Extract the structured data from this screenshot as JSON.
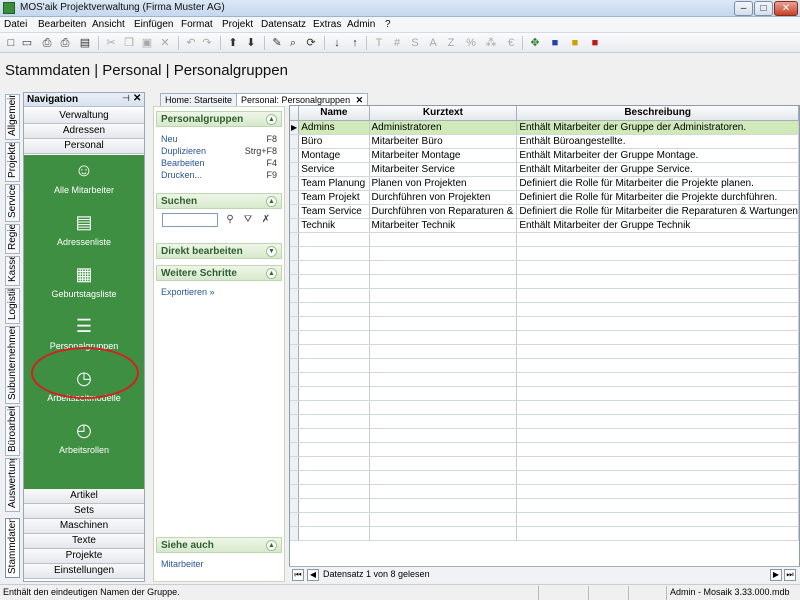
{
  "window": {
    "title": "MOS'aik Projektverwaltung (Firma Muster AG)",
    "minimize": "–",
    "maximize": "□",
    "close": "✕"
  },
  "menu": [
    "Datei",
    "Bearbeiten",
    "Ansicht",
    "Einfügen",
    "Format",
    "Projekt",
    "Datensatz",
    "Extras",
    "Admin",
    "?"
  ],
  "toolbar_icons": [
    "new-icon",
    "open-icon",
    "print-icon",
    "print-preview-icon",
    "cut-icon",
    "copy-icon",
    "paste-icon",
    "delete-icon",
    "undo-icon",
    "redo-icon",
    "arrow-up-icon",
    "arrow-down-icon",
    "pen-icon",
    "find-icon",
    "refresh-icon",
    "sort-az-icon",
    "sort-za-icon",
    "text-format-icon",
    "percent-icon",
    "currency-icon",
    "users-icon",
    "lock-blue-icon",
    "lock-yellow-icon",
    "lock-red-icon"
  ],
  "breadcrumb": "Stammdaten | Personal | Personalgruppen",
  "side_tabs": [
    "Allgemein",
    "Projekte",
    "Service",
    "Regie",
    "Kasse",
    "Logistik",
    "Subunternehmer",
    "Büroarbeiten",
    "Auswertungen",
    "Stammdaten"
  ],
  "navigation": {
    "title": "Navigation",
    "pin": "⊣",
    "close": "✕",
    "top_buttons": [
      "Verwaltung",
      "Adressen",
      "Personal"
    ],
    "items": [
      {
        "label": "Alle Mitarbeiter",
        "icon": "people-icon"
      },
      {
        "label": "Adressenliste",
        "icon": "address-list-icon"
      },
      {
        "label": "Geburtstagsliste",
        "icon": "calendar-icon"
      },
      {
        "label": "Personalgruppen",
        "icon": "database-group-icon"
      },
      {
        "label": "Arbeitszeitmodelle",
        "icon": "calendar-clock-icon"
      },
      {
        "label": "Arbeitsrollen",
        "icon": "database-clock-icon"
      }
    ],
    "bottom_buttons": [
      "Artikel",
      "Sets",
      "Maschinen",
      "Texte",
      "Projekte",
      "Einstellungen"
    ]
  },
  "tabs": [
    {
      "label": "Home: Startseite"
    },
    {
      "label": "Personal: Personalgruppen",
      "close": "✕"
    }
  ],
  "taskpane": {
    "groups": [
      {
        "title": "Personalgruppen",
        "chevron": "▲",
        "items": [
          {
            "label": "Neu",
            "shortcut": "F8"
          },
          {
            "label": "Duplizieren",
            "shortcut": "Strg+F8"
          },
          {
            "label": "Bearbeiten",
            "shortcut": "F4"
          },
          {
            "label": "Drucken...",
            "shortcut": "F9"
          }
        ]
      },
      {
        "title": "Suchen",
        "chevron": "▲"
      },
      {
        "title": "Direkt bearbeiten",
        "chevron": "▼"
      },
      {
        "title": "Weitere Schritte",
        "chevron": "▲",
        "items": [
          {
            "label": "Exportieren »"
          }
        ]
      },
      {
        "title": "Siehe auch",
        "chevron": "▲",
        "items": [
          {
            "label": "Mitarbeiter"
          }
        ]
      }
    ]
  },
  "grid": {
    "columns": [
      "Name",
      "Kurztext",
      "Beschreibung"
    ],
    "current_marker": "▶",
    "rows": [
      [
        "Admins",
        "Administratoren",
        "Enthält Mitarbeiter der Gruppe der Administratoren."
      ],
      [
        "Büro",
        "Mitarbeiter Büro",
        "Enthält Büroangestellte."
      ],
      [
        "Montage",
        "Mitarbeiter Montage",
        "Enthält Mitarbeiter der Gruppe Montage."
      ],
      [
        "Service",
        "Mitarbeiter Service",
        "Enthält Mitarbeiter der Gruppe Service."
      ],
      [
        "Team Planung",
        "Planen von Projekten",
        "Definiert die Rolle für Mitarbeiter die Projekte planen."
      ],
      [
        "Team Projekt",
        "Durchführen von Projekten",
        "Definiert die Rolle für Mitarbeiter die Projekte durchführen."
      ],
      [
        "Team Service",
        "Durchführen von Reparaturen &",
        "Definiert die Rolle für Mitarbeiter die Reparaturen & Wartungen"
      ],
      [
        "Technik",
        "Mitarbeiter Technik",
        "Enthält Mitarbeiter der Gruppe Technik"
      ]
    ],
    "record_text": "Datensatz 1 von 8 gelesen",
    "nav_first": "⏮",
    "nav_prev": "◀",
    "nav_next": "▶",
    "nav_last": "⏭"
  },
  "status": {
    "text": "Enthält den eindeutigen Namen der Gruppe.",
    "db": "Admin - Mosaik 3.33.000.mdb"
  }
}
